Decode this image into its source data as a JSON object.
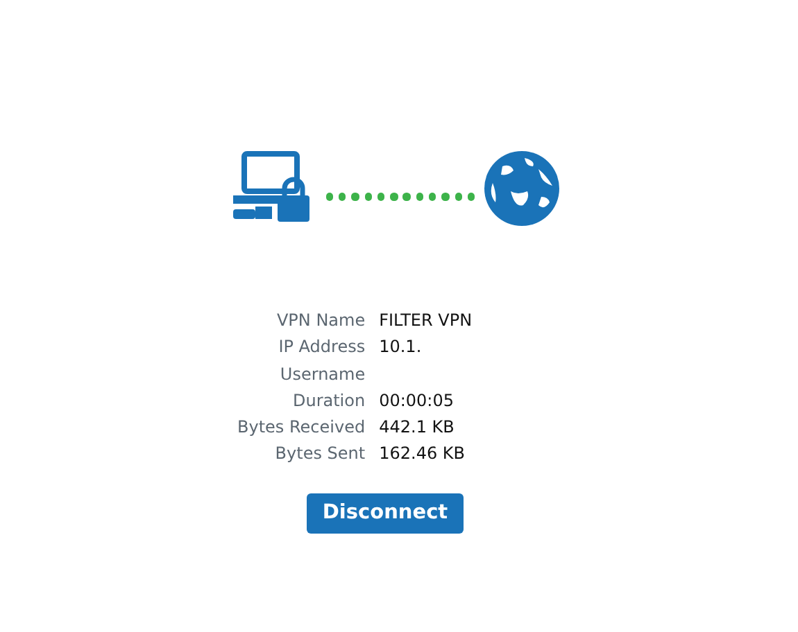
{
  "connection": {
    "connected": true
  },
  "details": [
    {
      "label": "VPN Name",
      "value": "FILTER VPN"
    },
    {
      "label": "IP Address",
      "value": "10.1."
    },
    {
      "label": "Username"
    },
    {
      "label": "Duration",
      "value": "00:00:05"
    },
    {
      "label": "Bytes Received",
      "value": "442.1 KB"
    },
    {
      "label": "Bytes Sent",
      "value": "162.46 KB"
    }
  ],
  "buttons": [
    {
      "label": "Disconnect"
    }
  ]
}
